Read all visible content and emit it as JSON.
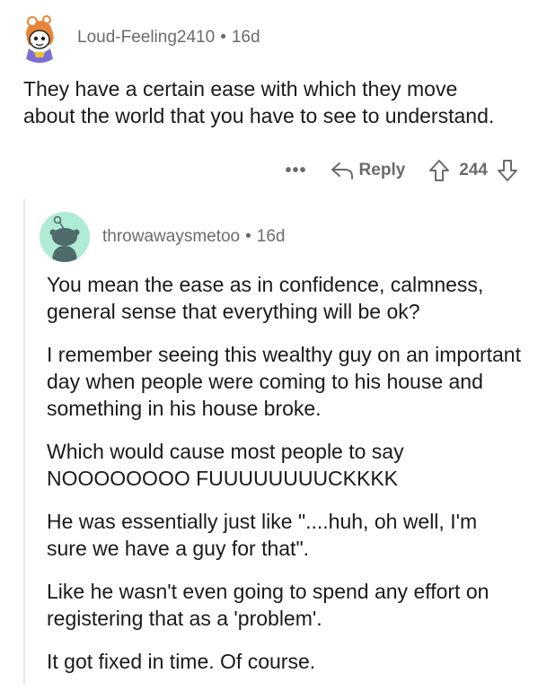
{
  "top_comment": {
    "username": "Loud-Feeling2410",
    "separator": "•",
    "age": "16d",
    "body": "They have a certain ease with which they move about the world that you have to see to understand.",
    "actions": {
      "more": "•••",
      "reply_label": "Reply",
      "vote_count": "244"
    }
  },
  "reply_comment": {
    "username": "throwawaysmetoo",
    "separator": "•",
    "age": "16d",
    "paragraphs": [
      "You mean the ease as in confidence, calmness, general sense that everything will be ok?",
      "I remember seeing this wealthy guy on an important day when people were coming to his house and something in his house broke.",
      "Which would cause most people to say NOOOOOOOO FUUUUUUUUCKKKK",
      "He was essentially just like \"....huh, oh well, I'm sure we have a guy for that\".",
      "Like he wasn't even going to spend any effort on registering that as a 'problem'.",
      "It got fixed in time. Of course."
    ]
  },
  "colors": {
    "text": "#1a1a1b",
    "meta": "#6b6b6b",
    "snoo_bg": "#b0ebd5",
    "thread_line": "#e6e6e6"
  },
  "icons": {
    "reply": "reply-arrow-icon",
    "upvote": "upvote-arrow-icon",
    "downvote": "downvote-arrow-icon"
  }
}
